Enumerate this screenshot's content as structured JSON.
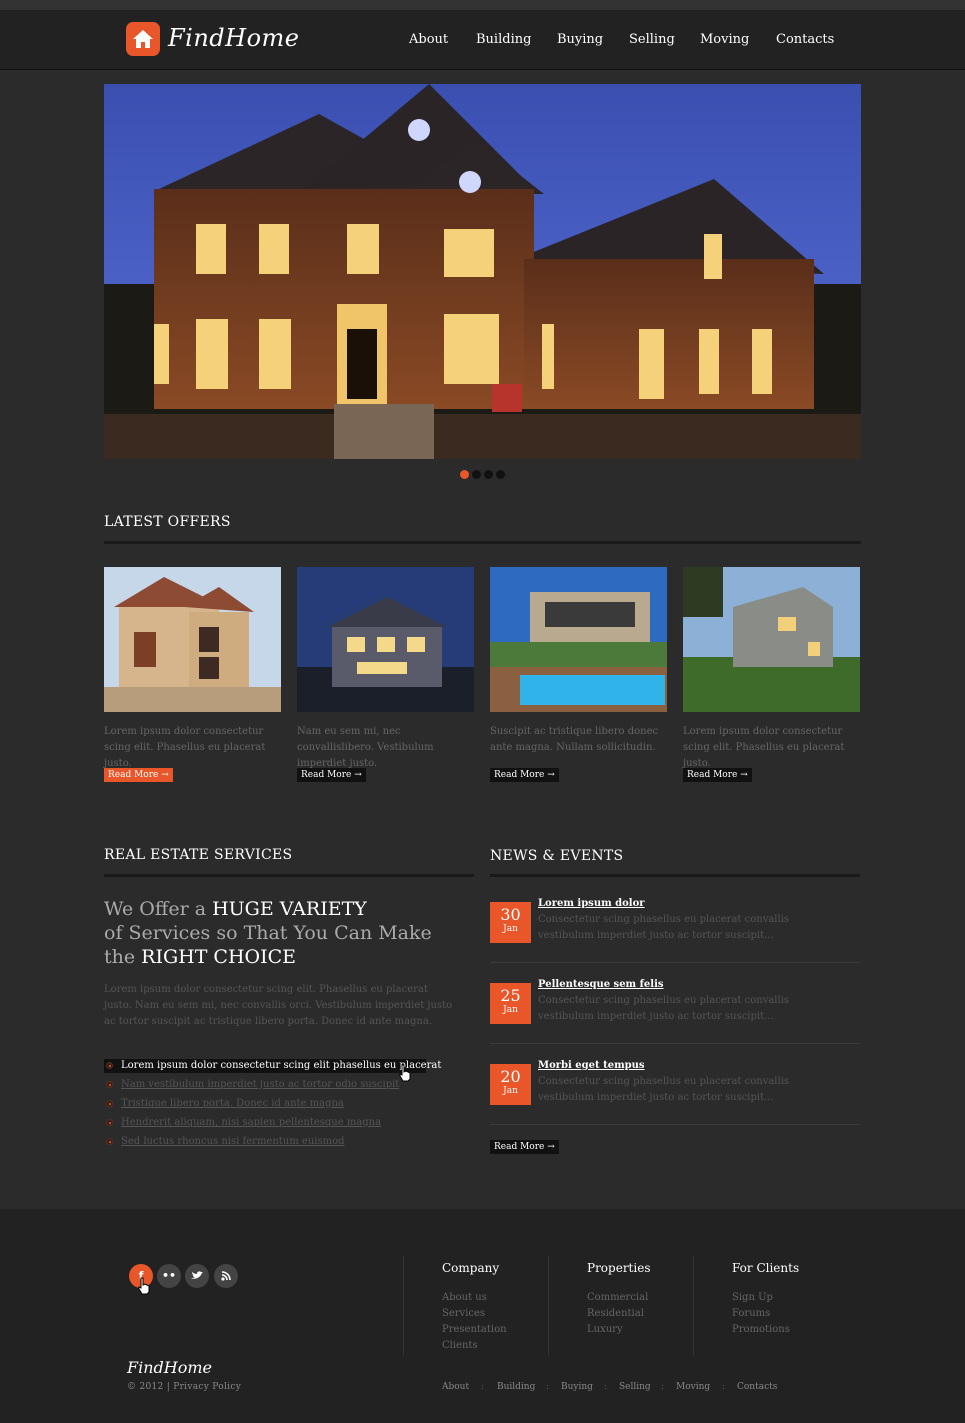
{
  "brand": {
    "name": "FindHome",
    "accent": "#e8562a"
  },
  "nav": [
    "About",
    "Building",
    "Buying",
    "Selling",
    "Moving",
    "Contacts"
  ],
  "slider": {
    "slides": 4,
    "active": 1
  },
  "latest": {
    "title": "LATEST OFFERS",
    "items": [
      {
        "text": "Lorem ipsum dolor consectetur scing elit. Phasellus eu placerat justo.",
        "more": "Read More →"
      },
      {
        "text": "Nam eu sem mi, nec convallislibero. Vestibulum imperdiet justo.",
        "more": "Read More →"
      },
      {
        "text": "Suscipit ac tristique libero donec ante magna. Nullam sollicitudin.",
        "more": "Read More →"
      },
      {
        "text": "Lorem ipsum dolor consectetur scing elit. Phasellus eu placerat justo.",
        "more": "Read More →"
      }
    ]
  },
  "services": {
    "title": "REAL ESTATE SERVICES",
    "head1": "We Offer a ",
    "head1b": "HUGE VARIETY",
    "head2": "of Services so That You Can Make",
    "head3": "the ",
    "head3b": "RIGHT CHOICE",
    "text": "Lorem ipsum dolor consectetur scing elit. Phasellus eu placerat justo. Nam eu sem mi, nec convallis orci. Vestibulum imperdiet justo ac tortor suscipit ac tristique libero porta. Donec id ante magna.",
    "links": [
      "Lorem ipsum dolor consectetur scing elit phasellus eu placerat",
      "Nam vestibulum imperdiet justo ac tortor odio suscipit",
      "Tristique libero porta. Donec id ante magna",
      "Hendrerit aliquam, nisi sapien pellentesque magna",
      "Sed luctus rhoncus nisi fermentum euismod"
    ]
  },
  "news": {
    "title": "NEWS & EVENTS",
    "items": [
      {
        "day": "30",
        "month": "Jan",
        "title": "Lorem ipsum dolor",
        "text": "Consectetur scing phasellus eu placerat convallis vestibulum imperdiet justo ac tortor suscipit..."
      },
      {
        "day": "25",
        "month": "Jan",
        "title": "Pellentesque sem felis",
        "text": "Consectetur scing phasellus eu placerat convallis vestibulum imperdiet justo ac tortor suscipit..."
      },
      {
        "day": "20",
        "month": "Jan",
        "title": "Morbi eget tempus",
        "text": "Consectetur scing phasellus eu placerat convallis vestibulum imperdiet justo ac tortor suscipit..."
      }
    ],
    "more": "Read More →"
  },
  "footer": {
    "company": {
      "title": "Company",
      "items": [
        "About us",
        "Services",
        "Presentation",
        "Clients"
      ]
    },
    "properties": {
      "title": "Properties",
      "items": [
        "Commercial",
        "Residential",
        "Luxury"
      ]
    },
    "clients": {
      "title": "For Clients",
      "items": [
        "Sign Up",
        "Forums",
        "Promotions"
      ]
    },
    "logo": "FindHome",
    "copyright": "© 2012 | Privacy Policy",
    "nav": [
      "About",
      "Building",
      "Buying",
      "Selling",
      "Moving",
      "Contacts"
    ]
  }
}
